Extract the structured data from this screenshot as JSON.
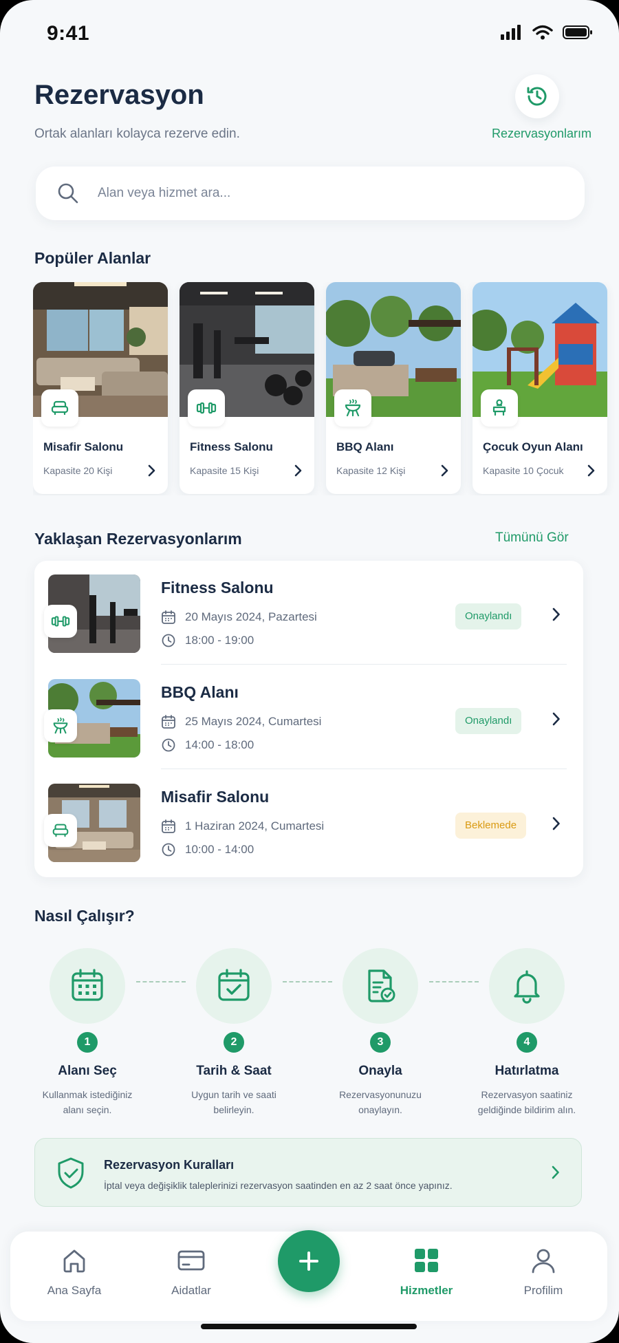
{
  "status_bar": {
    "time": "9:41"
  },
  "header": {
    "title": "Rezervasyon",
    "subtitle": "Ortak alanları kolayca rezerve edin.",
    "history_label": "Rezervasyonlarım"
  },
  "search": {
    "placeholder": "Alan veya hizmet ara..."
  },
  "popular": {
    "title": "Popüler Alanlar",
    "items": [
      {
        "name": "Misafir Salonu",
        "capacity": "Kapasite 20 Kişi",
        "icon": "sofa-icon"
      },
      {
        "name": "Fitness Salonu",
        "capacity": "Kapasite 15 Kişi",
        "icon": "dumbbell-icon"
      },
      {
        "name": "BBQ Alanı",
        "capacity": "Kapasite 12 Kişi",
        "icon": "grill-icon"
      },
      {
        "name": "Çocuk Oyun Alanı",
        "capacity": "Kapasite 10 Çocuk",
        "icon": "playground-icon"
      }
    ]
  },
  "upcoming": {
    "title": "Yaklaşan Rezervasyonlarım",
    "see_all": "Tümünü Gör",
    "items": [
      {
        "name": "Fitness Salonu",
        "date": "20 Mayıs 2024, Pazartesi",
        "time": "18:00 - 19:00",
        "status": "Onaylandı",
        "status_color": "#1f9a68"
      },
      {
        "name": "BBQ Alanı",
        "date": "25 Mayıs 2024, Cumartesi",
        "time": "14:00 - 18:00",
        "status": "Onaylandı",
        "status_color": "#1f9a68"
      },
      {
        "name": "Misafir Salonu",
        "date": "1 Haziran 2024, Cumartesi",
        "time": "10:00 - 14:00",
        "status": "Beklemede",
        "status_color": "#e0a21a"
      }
    ]
  },
  "how": {
    "title": "Nasıl Çalışır?",
    "steps": [
      {
        "num": "1",
        "title": "Alanı Seç",
        "desc1": "Kullanmak istediğiniz",
        "desc2": "alanı seçin.",
        "icon": "calendar-grid-icon"
      },
      {
        "num": "2",
        "title": "Tarih & Saat",
        "desc1": "Uygun tarih ve saati",
        "desc2": "belirleyin.",
        "icon": "calendar-check-icon"
      },
      {
        "num": "3",
        "title": "Onayla",
        "desc1": "Rezervasyonunuzu",
        "desc2": "onaylayın.",
        "icon": "document-check-icon"
      },
      {
        "num": "4",
        "title": "Hatırlatma",
        "desc1": "Rezervasyon saatiniz",
        "desc2": "geldiğinde bildirim alın.",
        "icon": "bell-icon"
      }
    ]
  },
  "rules": {
    "title": "Rezervasyon Kuralları",
    "text": "İptal veya değişiklik taleplerinizi rezervasyon saatinden en az 2 saat önce yapınız."
  },
  "nav": {
    "items": [
      {
        "label": "Ana Sayfa",
        "icon": "home-icon"
      },
      {
        "label": "Aidatlar",
        "icon": "card-icon"
      },
      {
        "label": "Hizmetler",
        "icon": "grid-icon",
        "active": true
      },
      {
        "label": "Profilim",
        "icon": "user-icon"
      }
    ],
    "fab_icon": "plus-icon"
  },
  "colors": {
    "accent": "#1f9a68",
    "text": "#1b2b44",
    "pending": "#e0a21a"
  }
}
